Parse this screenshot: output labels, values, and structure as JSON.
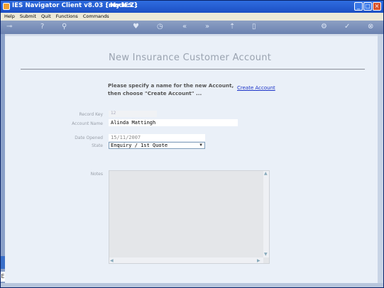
{
  "window": {
    "title": "IES Navigator Client v8.03 : My IES :",
    "mode": "[mode:Z]"
  },
  "menu": [
    "Help",
    "Submit",
    "Quit",
    "Functions",
    "Commands"
  ],
  "toolbar_icons": [
    "back-icon",
    "help-icon",
    "search-icon",
    "favorite-icon",
    "clock-icon",
    "rewind-icon",
    "forward-icon",
    "upload-icon",
    "copy-icon",
    "settings-icon",
    "check-icon",
    "close-icon"
  ],
  "page": {
    "title": "New Insurance Customer Account",
    "instruction_line1": "Please specify a name for the new Account,",
    "instruction_line2": "then choose \"Create Account\" ...",
    "create_link": "Create Account"
  },
  "form": {
    "record_key_label": "Record Key",
    "record_key_value": "12",
    "account_name_label": "Account Name",
    "account_name_value": "Alinda Mattingh",
    "date_opened_label": "Date Opened",
    "date_opened_value": "15/11/2007",
    "state_label": "State",
    "state_value": "Enquiry / 1st Quote",
    "notes_label": "Notes"
  }
}
